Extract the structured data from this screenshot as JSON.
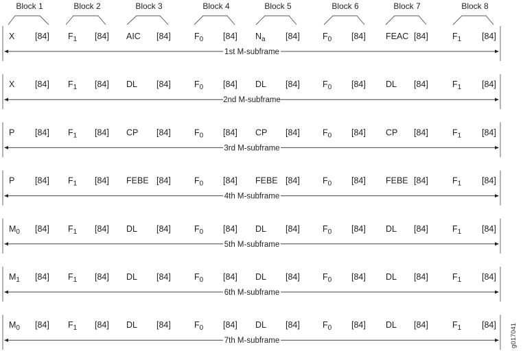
{
  "blocks": [
    "Block 1",
    "Block 2",
    "Block 3",
    "Block 4",
    "Block 5",
    "Block 6",
    "Block 7",
    "Block 8"
  ],
  "payload_label": "[84]",
  "subframes": [
    {
      "label": "1st M-subframe",
      "cells": [
        {
          "base": "X",
          "sub": ""
        },
        {
          "base": "F",
          "sub": "1"
        },
        {
          "base": "AIC",
          "sub": ""
        },
        {
          "base": "F",
          "sub": "0"
        },
        {
          "base": "N",
          "sub": "a"
        },
        {
          "base": "F",
          "sub": "0"
        },
        {
          "base": "FEAC",
          "sub": ""
        },
        {
          "base": "F",
          "sub": "1"
        }
      ]
    },
    {
      "label": "2nd M-subframe",
      "cells": [
        {
          "base": "X",
          "sub": ""
        },
        {
          "base": "F",
          "sub": "1"
        },
        {
          "base": "DL",
          "sub": ""
        },
        {
          "base": "F",
          "sub": "0"
        },
        {
          "base": "DL",
          "sub": ""
        },
        {
          "base": "F",
          "sub": "0"
        },
        {
          "base": "DL",
          "sub": ""
        },
        {
          "base": "F",
          "sub": "1"
        }
      ]
    },
    {
      "label": "3rd M-subframe",
      "cells": [
        {
          "base": "P",
          "sub": ""
        },
        {
          "base": "F",
          "sub": "1"
        },
        {
          "base": "CP",
          "sub": ""
        },
        {
          "base": "F",
          "sub": "0"
        },
        {
          "base": "CP",
          "sub": ""
        },
        {
          "base": "F",
          "sub": "0"
        },
        {
          "base": "CP",
          "sub": ""
        },
        {
          "base": "F",
          "sub": "1"
        }
      ]
    },
    {
      "label": "4th M-subframe",
      "cells": [
        {
          "base": "P",
          "sub": ""
        },
        {
          "base": "F",
          "sub": "1"
        },
        {
          "base": "FEBE",
          "sub": ""
        },
        {
          "base": "F",
          "sub": "0"
        },
        {
          "base": "FEBE",
          "sub": ""
        },
        {
          "base": "F",
          "sub": "0"
        },
        {
          "base": "FEBE",
          "sub": ""
        },
        {
          "base": "F",
          "sub": "1"
        }
      ]
    },
    {
      "label": "5th M-subframe",
      "cells": [
        {
          "base": "M",
          "sub": "0"
        },
        {
          "base": "F",
          "sub": "1"
        },
        {
          "base": "DL",
          "sub": ""
        },
        {
          "base": "F",
          "sub": "0"
        },
        {
          "base": "DL",
          "sub": ""
        },
        {
          "base": "F",
          "sub": "0"
        },
        {
          "base": "DL",
          "sub": ""
        },
        {
          "base": "F",
          "sub": "1"
        }
      ]
    },
    {
      "label": "6th M-subframe",
      "cells": [
        {
          "base": "M",
          "sub": "1"
        },
        {
          "base": "F",
          "sub": "1"
        },
        {
          "base": "DL",
          "sub": ""
        },
        {
          "base": "F",
          "sub": "0"
        },
        {
          "base": "DL",
          "sub": ""
        },
        {
          "base": "F",
          "sub": "0"
        },
        {
          "base": "DL",
          "sub": ""
        },
        {
          "base": "F",
          "sub": "1"
        }
      ]
    },
    {
      "label": "7th M-subframe",
      "cells": [
        {
          "base": "M",
          "sub": "0"
        },
        {
          "base": "F",
          "sub": "1"
        },
        {
          "base": "DL",
          "sub": ""
        },
        {
          "base": "F",
          "sub": "0"
        },
        {
          "base": "DL",
          "sub": ""
        },
        {
          "base": "F",
          "sub": "0"
        },
        {
          "base": "DL",
          "sub": ""
        },
        {
          "base": "F",
          "sub": "1"
        }
      ]
    }
  ],
  "figure_id": "g017041"
}
